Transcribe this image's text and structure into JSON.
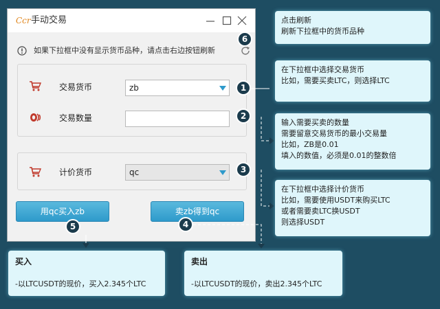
{
  "window": {
    "logo_text": "Ccr",
    "title": "手动交易"
  },
  "notice": {
    "text": "如果下拉框中没有显示货币品种，请点击右边按钮刷新"
  },
  "trade_currency": {
    "label": "交易货币",
    "selected": "zb"
  },
  "trade_amount": {
    "label": "交易数量",
    "value": ""
  },
  "quote_currency": {
    "label": "计价货币",
    "selected": "qc"
  },
  "buttons": {
    "buy_label": "用qc买入zb",
    "sell_label": "卖zb得到qc"
  },
  "markers": [
    "1",
    "2",
    "3",
    "4",
    "5",
    "6"
  ],
  "callouts": {
    "refresh": [
      "点击刷新",
      "刷新下拉框中的货币品种"
    ],
    "trade": [
      "在下拉框中选择交易货币",
      "比如，需要买卖LTC，则选择LTC"
    ],
    "amount": [
      "输入需要买卖的数量",
      "需要留意交易货币的最小交易量",
      "比如，ZB是0.01",
      "填入的数值，必须是0.01的整数倍"
    ],
    "quote": [
      "在下拉框中选择计价货币",
      "比如，需要使用USDT来购买LTC",
      "或者需要卖LTC换USDT",
      "则选择USDT"
    ]
  },
  "results": {
    "buy_title": "买入",
    "buy_desc": "-以LTCUSDT的现价，买入2.345个LTC",
    "sell_title": "卖出",
    "sell_desc": "-以LTCUSDT的现价，卖出2.345个LTC"
  },
  "colors": {
    "background": "#1e4d62",
    "button": "#3aa6d4",
    "callout": "#dff6fb",
    "marker": "#1b3b4c",
    "logo": "#e0861d",
    "icon": "#c0392b"
  }
}
